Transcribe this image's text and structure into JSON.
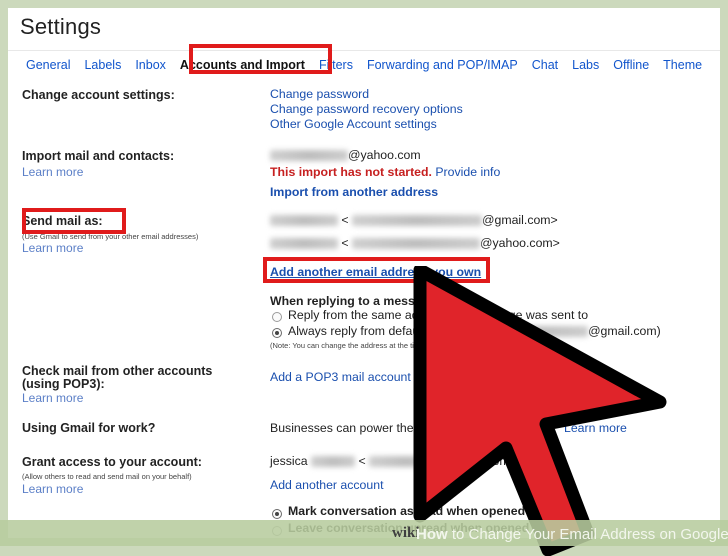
{
  "page": {
    "title": "Settings"
  },
  "tabs": [
    {
      "label": "General",
      "active": false
    },
    {
      "label": "Labels",
      "active": false
    },
    {
      "label": "Inbox",
      "active": false
    },
    {
      "label": "Accounts and Import",
      "active": true
    },
    {
      "label": "Filters",
      "active": false
    },
    {
      "label": "Forwarding and POP/IMAP",
      "active": false
    },
    {
      "label": "Chat",
      "active": false
    },
    {
      "label": "Labs",
      "active": false
    },
    {
      "label": "Offline",
      "active": false
    },
    {
      "label": "Theme",
      "active": false
    }
  ],
  "rows": {
    "change_account": {
      "label": "Change account settings:",
      "links": [
        "Change password",
        "Change password recovery options",
        "Other Google Account settings"
      ]
    },
    "import_mail": {
      "label": "Import mail and contacts:",
      "learn_more": "Learn more",
      "account_domain": "@yahoo.com",
      "status": "This import has not started.",
      "provide_info": "Provide info",
      "link": "Import from another address"
    },
    "send_mail_as": {
      "label": "Send mail as:",
      "sublabel": "(Use Gmail to send from your other email addresses)",
      "learn_more": "Learn more",
      "addresses": [
        {
          "separator": "<",
          "domain": "@gmail.com>"
        },
        {
          "separator": "<",
          "domain": "@yahoo.com>"
        }
      ],
      "add_link": "Add another email address you own",
      "reply_heading": "When replying to a message:",
      "reply_option_1": "Reply from the same address the message was sent to",
      "reply_option_2": "Always reply from default address",
      "reply_option_2_tail": "@gmail.com)",
      "reply_selected_index": 1,
      "note": "(Note: You can change the address at the time of reply)"
    },
    "pop3": {
      "label_line1": "Check mail from other accounts",
      "label_line2": "(using POP3):",
      "learn_more": "Learn more",
      "link": "Add a POP3 mail account you own"
    },
    "gmail_for_work": {
      "label": "Using Gmail for work?",
      "text": "Businesses can power their email with Google Apps.",
      "learn_more": "Learn more"
    },
    "grant_access": {
      "label": "Grant access to your account:",
      "sublabel": "(Allow others to read and send mail on your behalf)",
      "learn_more": "Learn more",
      "account_name": "jessica",
      "account_separator": "<",
      "account_domain": "@gmail.com>",
      "add_link": "Add another account",
      "option_1": "Mark conversation as read when opened by others",
      "option_2": "Leave conversation unread when opened by others",
      "selected_index": 0
    }
  },
  "highlights": {
    "tab_box": "Accounts and Import",
    "send_mail_as_box": "Send mail as:",
    "add_email_box": "Add another email address you own",
    "color": "#e01b1b"
  },
  "cursor": {
    "name": "mouse-pointer",
    "fill": "#e0242a",
    "stroke": "#000000"
  },
  "watermark": {
    "logo": "wiki",
    "brand_bold": "How",
    "text": " to Change Your Email Address on Google"
  },
  "colors": {
    "link": "#1a4fae",
    "tab_link": "#1155cc",
    "alert": "#c62020",
    "page_border": "#ccd9bc"
  }
}
